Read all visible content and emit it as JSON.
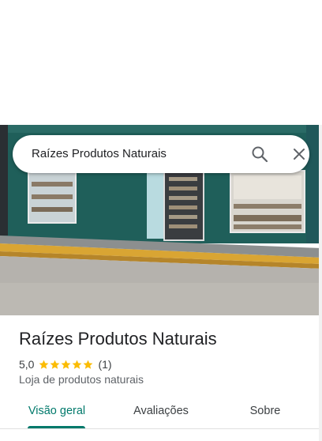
{
  "search": {
    "query": "Raízes Produtos Naturais"
  },
  "place": {
    "name": "Raízes Produtos Naturais",
    "rating": "5,0",
    "stars": 5,
    "review_count": "(1)",
    "category": "Loja de produtos naturais"
  },
  "tabs": [
    {
      "label": "Visão geral",
      "active": true
    },
    {
      "label": "Avaliações",
      "active": false
    },
    {
      "label": "Sobre",
      "active": false
    }
  ],
  "colors": {
    "accent": "#00796b",
    "star": "#fbbc04"
  },
  "icons": [
    "search-icon",
    "close-icon",
    "star-icon"
  ]
}
